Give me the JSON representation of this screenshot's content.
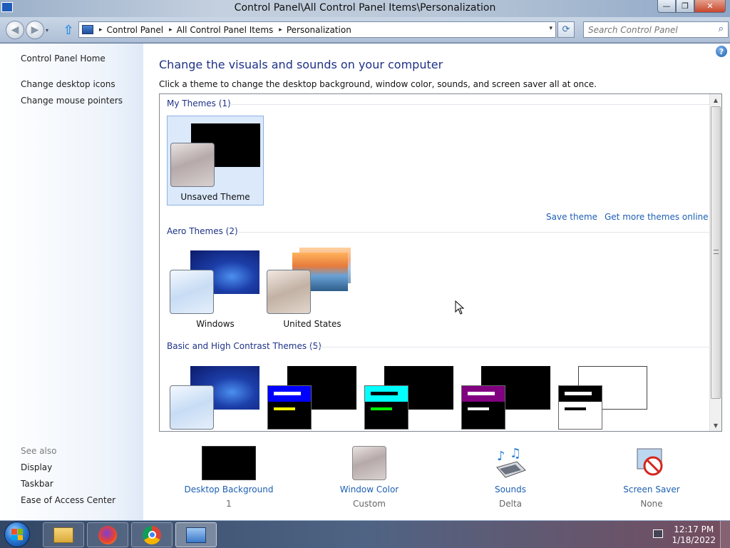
{
  "window": {
    "title": "Control Panel\\All Control Panel Items\\Personalization",
    "min_glyph": "—",
    "max_glyph": "❐",
    "close_glyph": "✕"
  },
  "nav": {
    "back_glyph": "◀",
    "forward_glyph": "▶",
    "drop_glyph": "▾",
    "up_glyph": "⇧",
    "breadcrumb": [
      "Control Panel",
      "All Control Panel Items",
      "Personalization"
    ],
    "crumb_sep": "▸",
    "refresh_glyph": "⟳",
    "search_placeholder": "Search Control Panel",
    "search_glyph": "⌕"
  },
  "sidebar": {
    "home": "Control Panel Home",
    "links": [
      "Change desktop icons",
      "Change mouse pointers"
    ],
    "see_also_label": "See also",
    "see_also": [
      "Display",
      "Taskbar",
      "Ease of Access Center"
    ]
  },
  "main": {
    "help_glyph": "?",
    "heading": "Change the visuals and sounds on your computer",
    "subtext": "Click a theme to change the desktop background, window color, sounds, and screen saver all at once.",
    "sections": {
      "my_themes": "My Themes (1)",
      "aero_themes": "Aero Themes (2)",
      "basic_themes": "Basic and High Contrast Themes (5)"
    },
    "my_themes": [
      {
        "label": "Unsaved Theme",
        "selected": true
      }
    ],
    "aero_themes": [
      {
        "label": "Windows"
      },
      {
        "label": "United States"
      }
    ],
    "links": {
      "save_theme": "Save theme",
      "get_more": "Get more themes online"
    },
    "scroll_up_glyph": "▲",
    "scroll_down_glyph": "▼"
  },
  "settings": [
    {
      "name": "Desktop Background",
      "value": "1"
    },
    {
      "name": "Window Color",
      "value": "Custom"
    },
    {
      "name": "Sounds",
      "value": "Delta"
    },
    {
      "name": "Screen Saver",
      "value": "None"
    }
  ],
  "taskbar": {
    "time": "12:17 PM",
    "date": "1/18/2022"
  },
  "colors": {
    "heading": "#1e3287",
    "link": "#1c5fb4",
    "selection": "#dbe9fb"
  }
}
